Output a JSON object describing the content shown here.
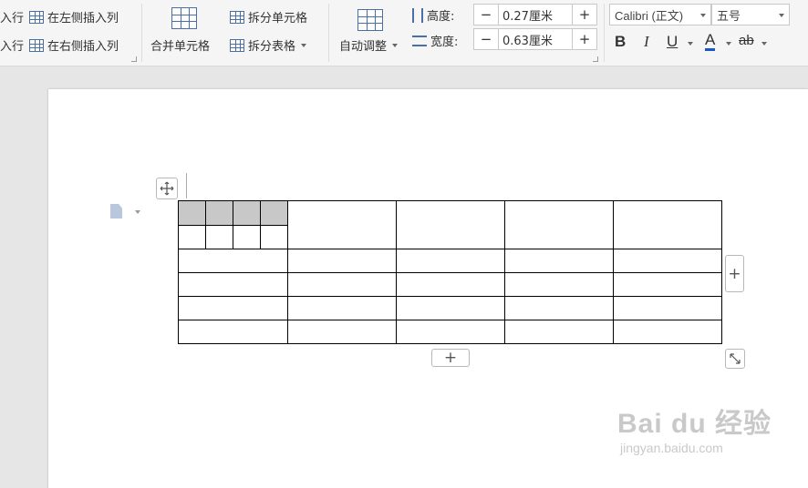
{
  "ribbon": {
    "rows_group": {
      "insert_row_above_partial": "入行",
      "insert_row_below_partial": "入行"
    },
    "insert_left_col": "在左侧插入列",
    "insert_right_col": "在右侧插入列",
    "merge_cells": "合并单元格",
    "split_cells": "拆分单元格",
    "split_table": "拆分表格",
    "auto_fit": "自动调整",
    "height": {
      "label": "高度:",
      "value": "0.27厘米",
      "minus": "−",
      "plus": "+"
    },
    "width": {
      "label": "宽度:",
      "value": "0.63厘米",
      "minus": "−",
      "plus": "+"
    },
    "font_name": "Calibri (正文)",
    "font_size": "五号",
    "bold": "B",
    "italic": "I",
    "underline": "U",
    "font_color": "A",
    "highlight": "ab"
  },
  "document": {
    "add_row_button": "+",
    "add_col_button": "+",
    "move_handle": "move-arrows",
    "resize_handle": "resize-arrows"
  },
  "watermark": {
    "brand": "Bai du 经验",
    "url": "jingyan.baidu.com"
  },
  "colors": {
    "ribbon_bg": "#f5f5f5",
    "selected_cell": "#c8c8c8",
    "accent": "#4a6fa5"
  }
}
